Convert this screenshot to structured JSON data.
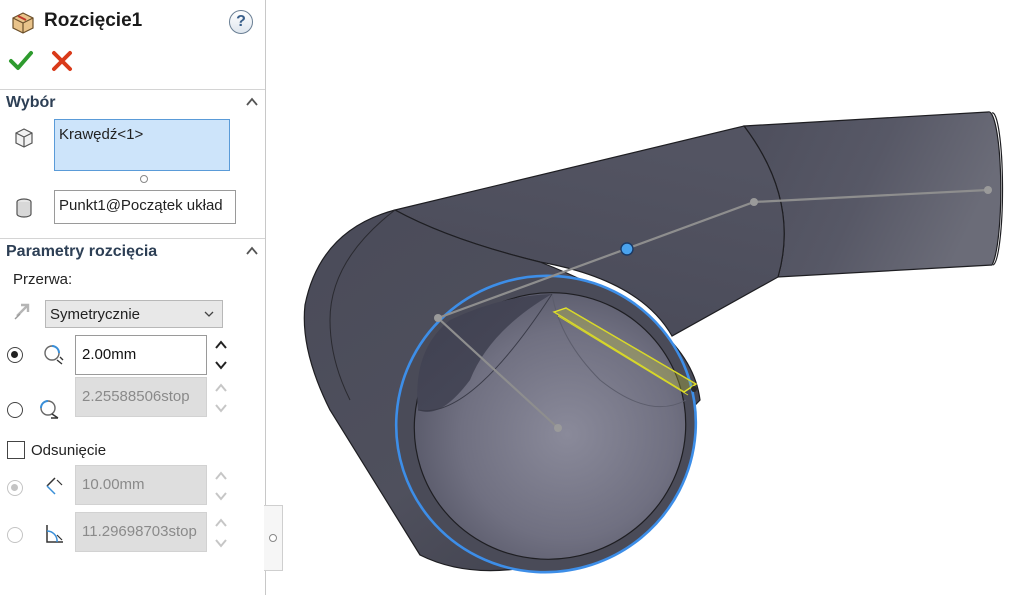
{
  "feature": {
    "title": "Rozcięcie1",
    "help_label": "?"
  },
  "selection": {
    "header": "Wybór",
    "edge_value": "Krawędź<1>",
    "point_value": "Punkt1@Początek układ"
  },
  "params": {
    "header": "Parametry rozcięcia",
    "gap_label": "Przerwa:",
    "gap_type": "Symetrycznie",
    "gap_value": "2.00mm",
    "gap_angle": "2.25588506stop",
    "offset_label": "Odsunięcie",
    "offset_value": "10.00mm",
    "offset_angle": "11.29698703stop"
  },
  "colors": {
    "accept": "#2e9b2e",
    "cancel": "#d93a1a",
    "selection_fill": "#cde4fa",
    "highlight_edge": "#3d8ee8",
    "preview_slot": "#e6e62a",
    "model_body": "#4a4b58"
  },
  "icons": {
    "feature": "rip-feature-icon",
    "accept": "checkmark-icon",
    "cancel": "close-x-icon",
    "edge_select": "edge-cube-icon",
    "point_select": "cylinder-point-icon",
    "gap_direction": "direction-arrow-icon",
    "gap_width": "gap-width-icon",
    "gap_angle": "gap-angle-icon",
    "offset_distance": "offset-distance-icon",
    "offset_angle": "offset-angle-icon"
  }
}
